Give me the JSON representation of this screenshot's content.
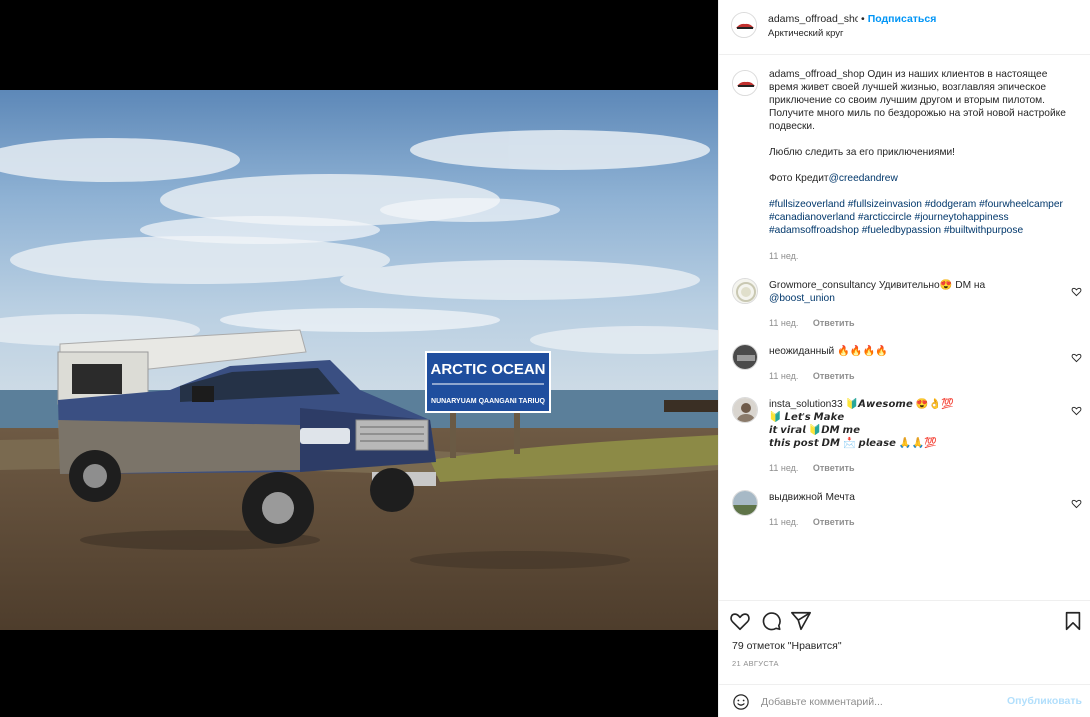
{
  "post": {
    "username": "adams_offroad_shop",
    "follow_label": "Подписаться",
    "dot": "•",
    "location": "Арктический круг"
  },
  "photo": {
    "sign_title": "ARCTIC OCEAN",
    "sign_subtitle": "NUNARYUAM QAANGANI TARIUQ"
  },
  "caption": {
    "username": "adams_offroad_shop",
    "text1": "Один из наших клиентов в настоящее время живет своей лучшей жизнью, возглавляя эпическое приключение со своим лучшим другом и вторым пилотом. Получите много миль по бездорожью на этой новой настройке подвески.",
    "text2": "Люблю следить за его приключениями!",
    "credit_prefix": "Фото Кредит",
    "credit_mention": "@creedandrew",
    "hashtags": "#fullsizeoverland #fullsizeinvasion #dodgeram #fourwheelcamper #canadianoverland #arcticcircle #journeytohappiness #adamsoffroadshop #fueledbypassion #builtwithpurpose",
    "time": "11 нед."
  },
  "comments": [
    {
      "user": "Growmore_consultancy",
      "text": "Удивительно😍 DM на",
      "mention": "@boost_union",
      "time": "11 нед.",
      "reply": "Ответить"
    },
    {
      "user": "неожиданный",
      "text": "🔥🔥🔥🔥",
      "time": "11 нед.",
      "reply": "Ответить"
    },
    {
      "user": "insta_solution33",
      "line1": "🔰𝘼𝙬𝙚𝙨𝙤𝙢𝙚 😍👌💯",
      "line2": "🔰 𝙇𝙚𝙩'𝙨 𝙈𝙖𝙠𝙚",
      "line3": "𝙞𝙩 𝙫𝙞𝙧𝙖𝙡 🔰𝘿𝙈 𝙢𝙚",
      "line4": "𝙩𝙝𝙞𝙨 𝙥𝙤𝙨𝙩 𝘿𝙈 📩 𝙥𝙡𝙚𝙖𝙨𝙚 🙏🙏💯",
      "time": "11 нед.",
      "reply": "Ответить"
    },
    {
      "user": "выдвижной",
      "text": "Мечта",
      "time": "11 нед.",
      "reply": "Ответить"
    }
  ],
  "likes": "79 отметок \"Нравится\"",
  "date": "21 АВГУСТА",
  "add_comment": {
    "placeholder": "Добавьте комментарий...",
    "publish": "Опубликовать"
  },
  "icons": [
    "heart-icon",
    "comment-icon",
    "share-icon",
    "bookmark-icon",
    "emoji-icon"
  ]
}
